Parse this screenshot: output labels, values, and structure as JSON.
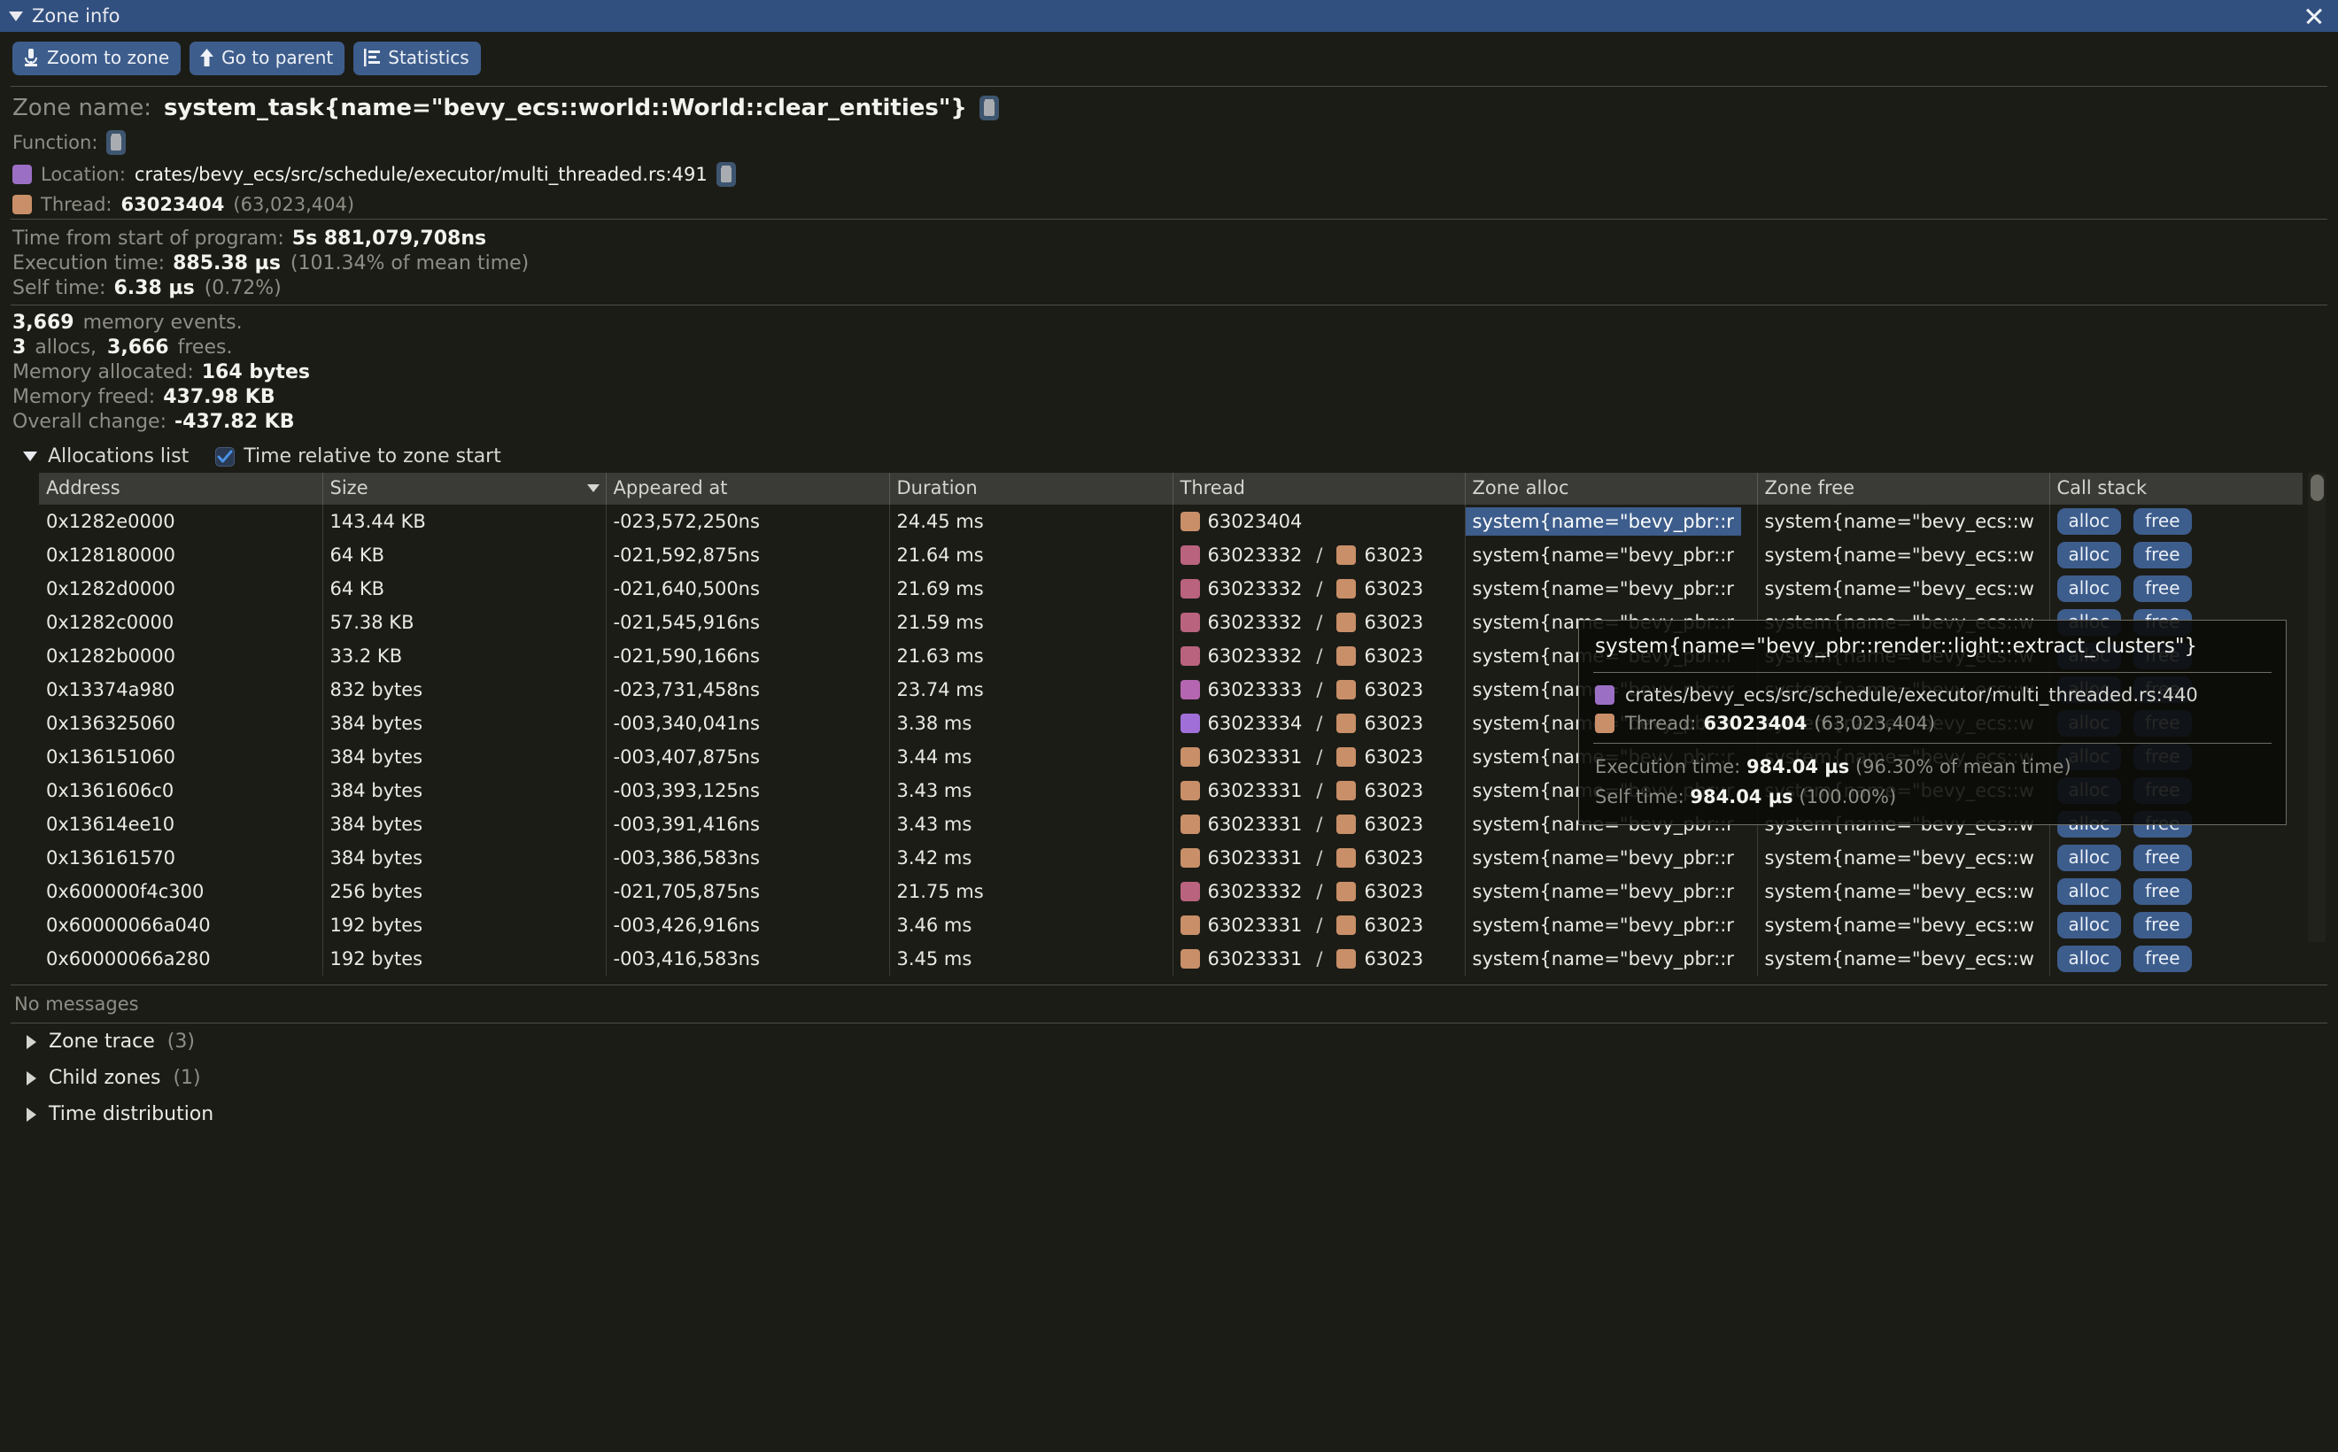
{
  "window": {
    "title": "Zone info",
    "collapse_icon": "triangle-down-icon",
    "close_icon": "close-icon"
  },
  "toolbar": {
    "zoom_to_zone": "Zoom to zone",
    "go_to_parent": "Go to parent",
    "statistics": "Statistics"
  },
  "zone": {
    "name_label": "Zone name:",
    "name_value": "system_task{name=\"bevy_ecs::world::World::clear_entities\"}",
    "function_label": "Function:",
    "location_label": "Location:",
    "location_value": "crates/bevy_ecs/src/schedule/executor/multi_threaded.rs:491",
    "location_color": "#9b6fc4",
    "thread_label": "Thread:",
    "thread_value": "63023404",
    "thread_paren": "(63,023,404)",
    "thread_color": "#c88f68"
  },
  "timing": {
    "time_from_start_label": "Time from start of program:",
    "time_from_start_value": "5s 881,079,708ns",
    "execution_time_label": "Execution time:",
    "execution_time_value": "885.38 µs",
    "execution_time_pct": "(101.34% of mean time)",
    "self_time_label": "Self time:",
    "self_time_value": "6.38 µs",
    "self_time_pct": "(0.72%)"
  },
  "memory": {
    "events_count": "3,669",
    "events_label": "memory events.",
    "allocs_count": "3",
    "allocs_label": "allocs,",
    "frees_count": "3,666",
    "frees_label": "frees.",
    "allocated_label": "Memory allocated:",
    "allocated_value": "164 bytes",
    "freed_label": "Memory freed:",
    "freed_value": "437.98 KB",
    "overall_label": "Overall change:",
    "overall_value": "-437.82 KB"
  },
  "allocations": {
    "section_title": "Allocations list",
    "checkbox_label": "Time relative to zone start",
    "checkbox_checked": true,
    "columns": [
      "Address",
      "Size",
      "Appeared at",
      "Duration",
      "Thread",
      "Zone alloc",
      "Zone free",
      "Call stack"
    ],
    "sorted_column_index": 1,
    "alloc_button_label": "alloc",
    "free_button_label": "free",
    "rows": [
      {
        "address": "0x1282e0000",
        "size": "143.44 KB",
        "appeared_at": "-023,572,250ns",
        "duration": "24.45 ms",
        "thread_a": "63023404",
        "thread_a_color": "#c88f68",
        "thread_b": "",
        "thread_b_color": "",
        "zone_alloc": "system{name=\"bevy_pbr::r",
        "zone_free": "system{name=\"bevy_ecs::w",
        "zone_alloc_selected": true
      },
      {
        "address": "0x128180000",
        "size": "64 KB",
        "appeared_at": "-021,592,875ns",
        "duration": "21.64 ms",
        "thread_a": "63023332",
        "thread_a_color": "#b9637f",
        "thread_b": "63023",
        "thread_b_color": "#c88f68",
        "zone_alloc": "system{name=\"bevy_pbr::r",
        "zone_free": "system{name=\"bevy_ecs::w",
        "zone_alloc_selected": false
      },
      {
        "address": "0x1282d0000",
        "size": "64 KB",
        "appeared_at": "-021,640,500ns",
        "duration": "21.69 ms",
        "thread_a": "63023332",
        "thread_a_color": "#b9637f",
        "thread_b": "63023",
        "thread_b_color": "#c88f68",
        "zone_alloc": "system{name=\"bevy_pbr::r",
        "zone_free": "system{name=\"bevy_ecs::w",
        "zone_alloc_selected": false
      },
      {
        "address": "0x1282c0000",
        "size": "57.38 KB",
        "appeared_at": "-021,545,916ns",
        "duration": "21.59 ms",
        "thread_a": "63023332",
        "thread_a_color": "#b9637f",
        "thread_b": "63023",
        "thread_b_color": "#c88f68",
        "zone_alloc": "system{name=\"bevy_pbr::r",
        "zone_free": "system{name=\"bevy_ecs::w",
        "zone_alloc_selected": false
      },
      {
        "address": "0x1282b0000",
        "size": "33.2 KB",
        "appeared_at": "-021,590,166ns",
        "duration": "21.63 ms",
        "thread_a": "63023332",
        "thread_a_color": "#b9637f",
        "thread_b": "63023",
        "thread_b_color": "#c88f68",
        "zone_alloc": "system{name=\"bevy_pbr::r",
        "zone_free": "system{name=\"bevy_ecs::w",
        "zone_alloc_selected": false
      },
      {
        "address": "0x13374a980",
        "size": "832 bytes",
        "appeared_at": "-023,731,458ns",
        "duration": "23.74 ms",
        "thread_a": "63023333",
        "thread_a_color": "#b566b0",
        "thread_b": "63023",
        "thread_b_color": "#c88f68",
        "zone_alloc": "system{name=\"bevy_pbr::r",
        "zone_free": "system{name=\"bevy_ecs::w",
        "zone_alloc_selected": false
      },
      {
        "address": "0x136325060",
        "size": "384 bytes",
        "appeared_at": "-003,340,041ns",
        "duration": "3.38 ms",
        "thread_a": "63023334",
        "thread_a_color": "#a070d8",
        "thread_b": "63023",
        "thread_b_color": "#c88f68",
        "zone_alloc": "system{name=\"bevy_pbr::r",
        "zone_free": "system{name=\"bevy_ecs::w",
        "zone_alloc_selected": false
      },
      {
        "address": "0x136151060",
        "size": "384 bytes",
        "appeared_at": "-003,407,875ns",
        "duration": "3.44 ms",
        "thread_a": "63023331",
        "thread_a_color": "#c88f68",
        "thread_b": "63023",
        "thread_b_color": "#c88f68",
        "zone_alloc": "system{name=\"bevy_pbr::r",
        "zone_free": "system{name=\"bevy_ecs::w",
        "zone_alloc_selected": false
      },
      {
        "address": "0x1361606c0",
        "size": "384 bytes",
        "appeared_at": "-003,393,125ns",
        "duration": "3.43 ms",
        "thread_a": "63023331",
        "thread_a_color": "#c88f68",
        "thread_b": "63023",
        "thread_b_color": "#c88f68",
        "zone_alloc": "system{name=\"bevy_pbr::r",
        "zone_free": "system{name=\"bevy_ecs::w",
        "zone_alloc_selected": false
      },
      {
        "address": "0x13614ee10",
        "size": "384 bytes",
        "appeared_at": "-003,391,416ns",
        "duration": "3.43 ms",
        "thread_a": "63023331",
        "thread_a_color": "#c88f68",
        "thread_b": "63023",
        "thread_b_color": "#c88f68",
        "zone_alloc": "system{name=\"bevy_pbr::r",
        "zone_free": "system{name=\"bevy_ecs::w",
        "zone_alloc_selected": false
      },
      {
        "address": "0x136161570",
        "size": "384 bytes",
        "appeared_at": "-003,386,583ns",
        "duration": "3.42 ms",
        "thread_a": "63023331",
        "thread_a_color": "#c88f68",
        "thread_b": "63023",
        "thread_b_color": "#c88f68",
        "zone_alloc": "system{name=\"bevy_pbr::r",
        "zone_free": "system{name=\"bevy_ecs::w",
        "zone_alloc_selected": false
      },
      {
        "address": "0x600000f4c300",
        "size": "256 bytes",
        "appeared_at": "-021,705,875ns",
        "duration": "21.75 ms",
        "thread_a": "63023332",
        "thread_a_color": "#b9637f",
        "thread_b": "63023",
        "thread_b_color": "#c88f68",
        "zone_alloc": "system{name=\"bevy_pbr::r",
        "zone_free": "system{name=\"bevy_ecs::w",
        "zone_alloc_selected": false
      },
      {
        "address": "0x60000066a040",
        "size": "192 bytes",
        "appeared_at": "-003,426,916ns",
        "duration": "3.46 ms",
        "thread_a": "63023331",
        "thread_a_color": "#c88f68",
        "thread_b": "63023",
        "thread_b_color": "#c88f68",
        "zone_alloc": "system{name=\"bevy_pbr::r",
        "zone_free": "system{name=\"bevy_ecs::w",
        "zone_alloc_selected": false
      },
      {
        "address": "0x60000066a280",
        "size": "192 bytes",
        "appeared_at": "-003,416,583ns",
        "duration": "3.45 ms",
        "thread_a": "63023331",
        "thread_a_color": "#c88f68",
        "thread_b": "63023",
        "thread_b_color": "#c88f68",
        "zone_alloc": "system{name=\"bevy_pbr::r",
        "zone_free": "system{name=\"bevy_ecs::w",
        "zone_alloc_selected": false
      }
    ]
  },
  "tooltip": {
    "title": "system{name=\"bevy_pbr::render::light::extract_clusters\"}",
    "location": "crates/bevy_ecs/src/schedule/executor/multi_threaded.rs:440",
    "location_color": "#9b6fc4",
    "thread_label": "Thread:",
    "thread_value": "63023404",
    "thread_paren": "(63,023,404)",
    "thread_color": "#c88f68",
    "execution_time_label": "Execution time:",
    "execution_time_value": "984.04 µs",
    "execution_time_pct": "(96.30% of mean time)",
    "self_time_label": "Self time:",
    "self_time_value": "984.04 µs",
    "self_time_pct": "(100.00%)"
  },
  "footer": {
    "no_messages": "No messages",
    "zone_trace_label": "Zone trace",
    "zone_trace_count": "(3)",
    "child_zones_label": "Child zones",
    "child_zones_count": "(1)",
    "time_distribution_label": "Time distribution"
  }
}
